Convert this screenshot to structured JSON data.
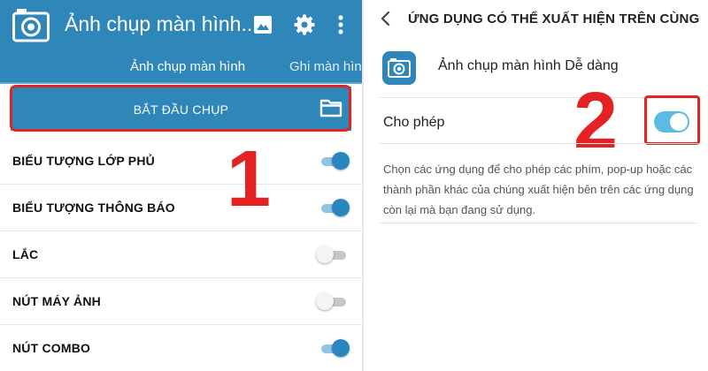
{
  "colors": {
    "primary": "#2f86b8",
    "highlight": "#e52223",
    "switch_on": "#2a86bf",
    "big_switch_on": "#5bbbe3"
  },
  "left": {
    "appbar": {
      "title": "Ảnh chụp màn hình...",
      "icons": [
        "camera-icon",
        "gallery-icon",
        "gear-icon",
        "more-vert-icon"
      ]
    },
    "tabs": [
      {
        "label": "Ảnh chụp màn hình",
        "selected": true
      },
      {
        "label": "Ghi màn hình",
        "selected": false
      }
    ],
    "start_button": {
      "label": "BẮT ĐẦU CHỤP",
      "icon": "folder-icon"
    },
    "annotation_number": "1",
    "settings": [
      {
        "label": "BIỂU TƯỢNG LỚP PHỦ",
        "on": true
      },
      {
        "label": "BIỂU TƯỢNG THÔNG BÁO",
        "on": true
      },
      {
        "label": "LẮC",
        "on": false
      },
      {
        "label": "NÚT MÁY ẢNH",
        "on": false
      },
      {
        "label": "NÚT COMBO",
        "on": true
      }
    ]
  },
  "right": {
    "title": "ỨNG DỤNG CÓ THỂ XUẤT HIỆN TRÊN CÙNG",
    "app_name": "Ảnh chụp màn hình Dễ dàng",
    "permission": {
      "label": "Cho phép",
      "on": true
    },
    "annotation_number": "2",
    "description": "Chọn các ứng dụng để cho phép các phím, pop-up hoặc các thành phần khác của chúng xuất hiện bên trên các ứng dụng còn lại mà bạn đang sử dụng."
  }
}
